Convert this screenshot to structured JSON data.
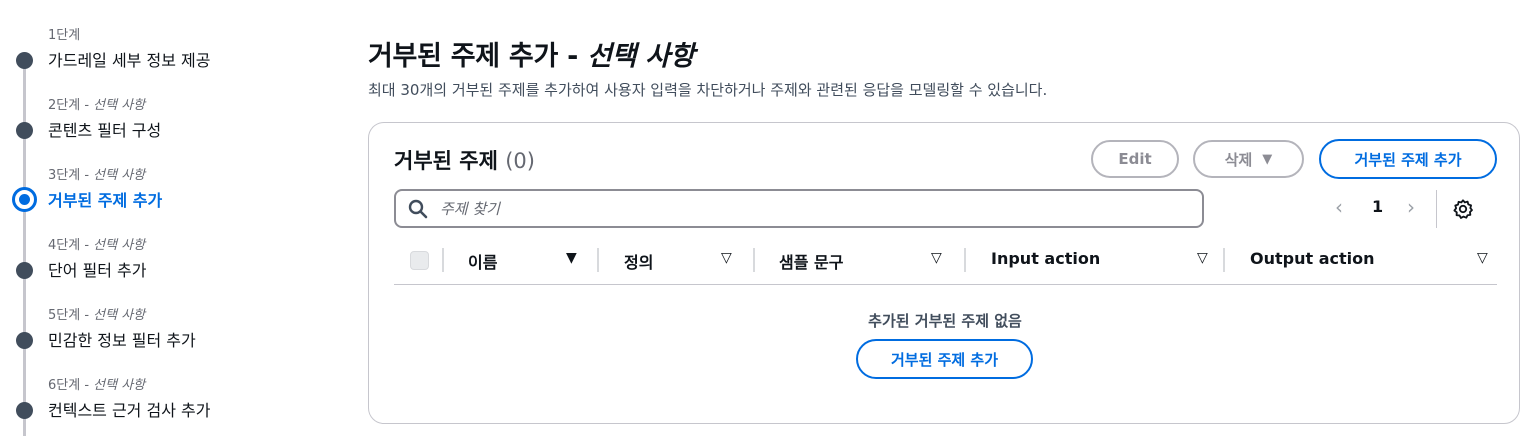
{
  "steps": [
    {
      "num": "1단계",
      "optional": "",
      "title": "가드레일 세부 정보 제공",
      "active": false
    },
    {
      "num": "2단계",
      "optional": "선택 사항",
      "title": "콘텐츠 필터 구성",
      "active": false
    },
    {
      "num": "3단계",
      "optional": "선택 사항",
      "title": "거부된 주제 추가",
      "active": true
    },
    {
      "num": "4단계",
      "optional": "선택 사항",
      "title": "단어 필터 추가",
      "active": false
    },
    {
      "num": "5단계",
      "optional": "선택 사항",
      "title": "민감한 정보 필터 추가",
      "active": false
    },
    {
      "num": "6단계",
      "optional": "선택 사항",
      "title": "컨텍스트 근거 검사 추가",
      "active": false
    }
  ],
  "step_optional_separator": " - ",
  "header": {
    "title": "거부된 주제 추가 - ",
    "title_optional": "선택 사항",
    "description": "최대 30개의 거부된 주제를 추가하여 사용자 입력을 차단하거나 주제와 관련된 응답을 모델링할 수 있습니다."
  },
  "table": {
    "title": "거부된 주제",
    "count": "(0)",
    "edit_label": "Edit",
    "delete_label": "삭제",
    "add_label": "거부된 주제 추가",
    "search_placeholder": "주제 찾기",
    "page_current": "1",
    "columns": [
      "이름",
      "정의",
      "샘플 문구",
      "Input action",
      "Output action"
    ],
    "empty_text": "추가된 거부된 주제 없음",
    "empty_add_label": "거부된 주제 추가"
  },
  "colors": {
    "accent": "#006ce0",
    "step_dot": "#414d5c",
    "border": "#c6c6cd"
  }
}
